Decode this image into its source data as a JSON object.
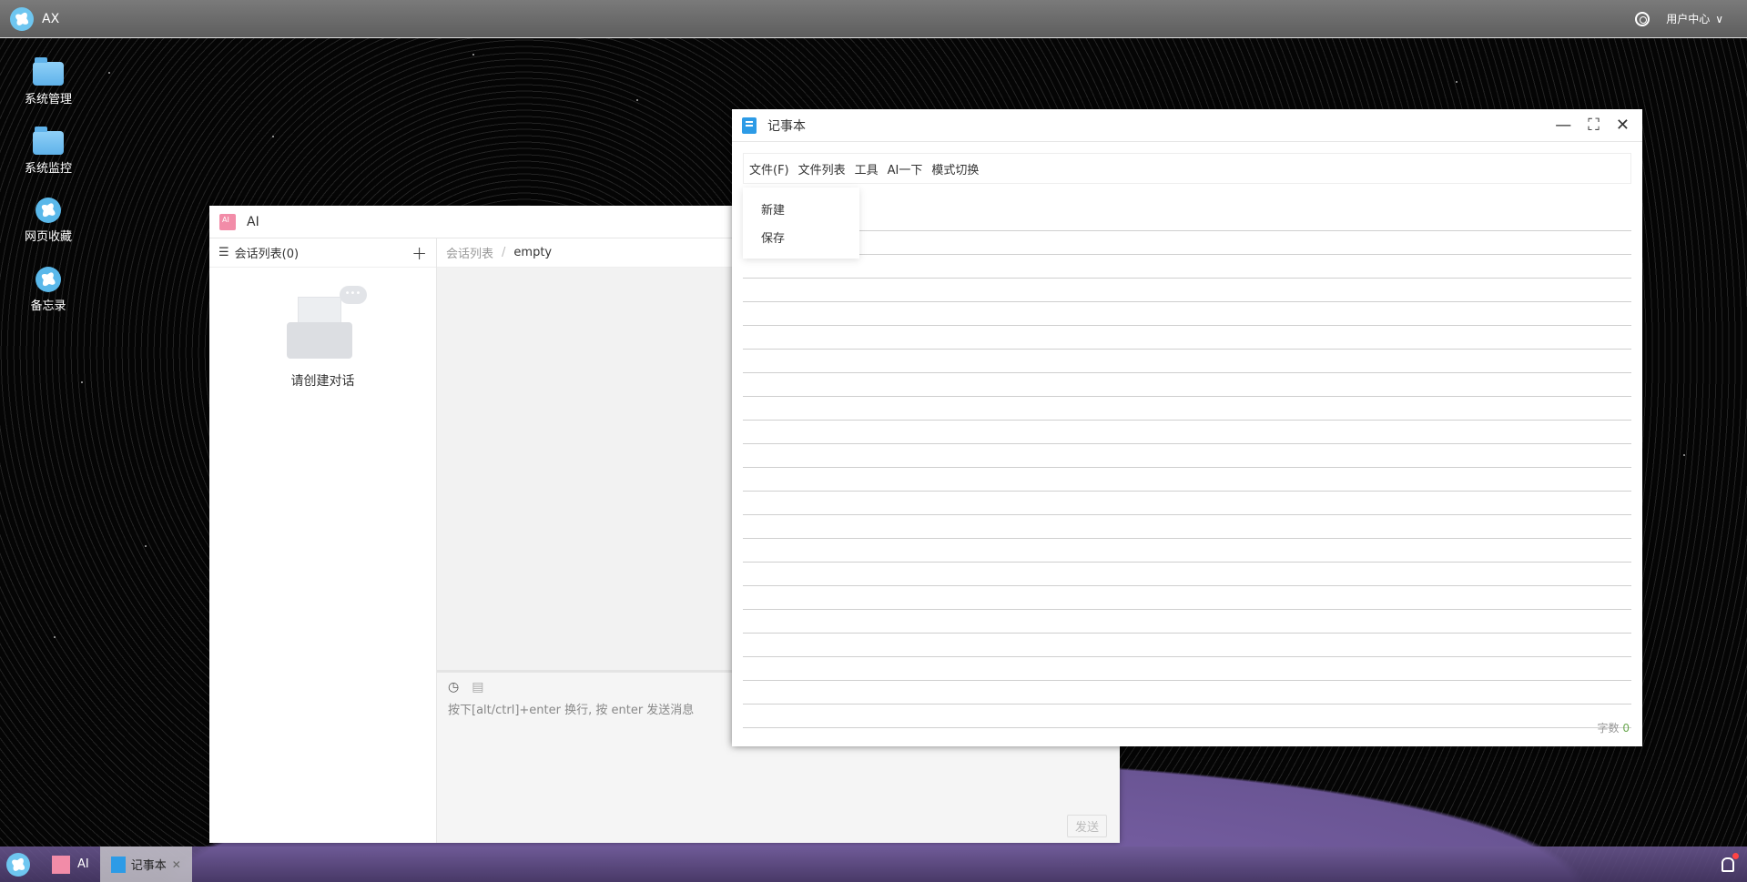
{
  "topbar": {
    "app_name": "AX",
    "user_center": "用户中心",
    "chevron": "∨"
  },
  "desktop_icons": [
    {
      "label": "系统管理",
      "icon": "folder-icon"
    },
    {
      "label": "系统监控",
      "icon": "folder-icon"
    },
    {
      "label": "网页收藏",
      "icon": "fan-icon"
    },
    {
      "label": "备忘录",
      "icon": "fan-icon"
    }
  ],
  "ai_window": {
    "title": "AI",
    "session_list_label": "会话列表(0)",
    "add_symbol": "+",
    "empty_text": "请创建对话",
    "breadcrumb_root": "会话列表",
    "breadcrumb_sep": "/",
    "breadcrumb_current": "empty",
    "input_placeholder": "按下[alt/ctrl]+enter 换行, 按 enter 发送消息",
    "send_label": "发送"
  },
  "notepad_window": {
    "title": "记事本",
    "menu": [
      "文件(F)",
      "文件列表",
      "工具",
      "AI一下",
      "模式切换"
    ],
    "file_menu_items": [
      "新建",
      "保存"
    ],
    "word_count_label": "字数",
    "word_count_value": "0"
  },
  "taskbar": {
    "items": [
      {
        "label": "AI",
        "active": false
      },
      {
        "label": "记事本",
        "active": true
      }
    ],
    "close_symbol": "✕"
  },
  "colors": {
    "accent_blue": "#2d9be6",
    "ai_pink": "#f28ca8",
    "wordcount_green": "#6aa84f"
  }
}
